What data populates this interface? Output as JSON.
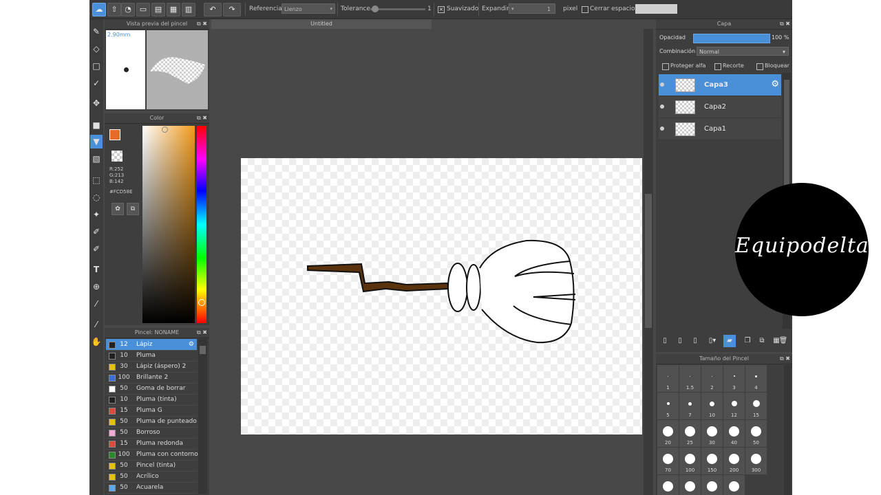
{
  "toolbar": {
    "referencia_label": "Referencia",
    "referencia_value": "Lienzo",
    "tolerancia_label": "Tolerance",
    "tolerancia_value": "1",
    "suavizado_label": "Suavizado",
    "expandir_label": "Expandir",
    "expandir_value": "1",
    "expandir_unit": "pixel",
    "cerrar_label": "Cerrar espacios"
  },
  "canvas": {
    "tab_title": "Untitled"
  },
  "brush_preview": {
    "title": "Vista previa del pincel",
    "size_text": "2.90mm"
  },
  "color_panel": {
    "title": "Color",
    "rgb_r": "R:252",
    "rgb_g": "G:213",
    "rgb_b": "B:142",
    "hex": "#FCD58E",
    "current_color": "#e86a2a"
  },
  "brush_panel": {
    "title": "Pincel: NONAME",
    "items": [
      {
        "size": "12",
        "name": "Lápiz",
        "color": "#222222"
      },
      {
        "size": "10",
        "name": "Pluma",
        "color": "#222222"
      },
      {
        "size": "30",
        "name": "Lápiz (áspero) 2",
        "color": "#e8c20a"
      },
      {
        "size": "100",
        "name": "Brillante 2",
        "color": "#3a6fd8"
      },
      {
        "size": "50",
        "name": "Goma de borrar",
        "color": "#ffffff"
      },
      {
        "size": "10",
        "name": "Pluma (tinta)",
        "color": "#222222"
      },
      {
        "size": "15",
        "name": "Pluma G",
        "color": "#e04a3a"
      },
      {
        "size": "50",
        "name": "Pluma de punteado",
        "color": "#e8c20a"
      },
      {
        "size": "50",
        "name": "Borroso",
        "color": "#f4a8d8"
      },
      {
        "size": "15",
        "name": "Pluma redonda",
        "color": "#e04a3a"
      },
      {
        "size": "100",
        "name": "Pluma con contorno",
        "color": "#2a8a2a"
      },
      {
        "size": "50",
        "name": "Pincel (tinta)",
        "color": "#e8c20a"
      },
      {
        "size": "50",
        "name": "Acrílico",
        "color": "#e8c20a"
      },
      {
        "size": "50",
        "name": "Acuarela",
        "color": "#5aaaf0"
      }
    ]
  },
  "layer_panel": {
    "title": "Capa",
    "opacity_label": "Opacidad",
    "opacity_value": "100 %",
    "blend_label": "Combinación",
    "blend_value": "Normal",
    "protect_alpha": "Proteger alfa",
    "clipping": "Recorte",
    "lock": "Bloquear",
    "layers": [
      {
        "name": "Capa3"
      },
      {
        "name": "Capa2"
      },
      {
        "name": "Capa1"
      }
    ]
  },
  "size_panel": {
    "title": "Tamaño del Pincel",
    "sizes": [
      "1",
      "1.5",
      "2",
      "3",
      "4",
      "5",
      "7",
      "10",
      "12",
      "15",
      "20",
      "25",
      "30",
      "40",
      "50",
      "70",
      "100",
      "150",
      "200",
      "300",
      "",
      "",
      "",
      ""
    ]
  },
  "watermark": {
    "text": "Equipodelta"
  }
}
